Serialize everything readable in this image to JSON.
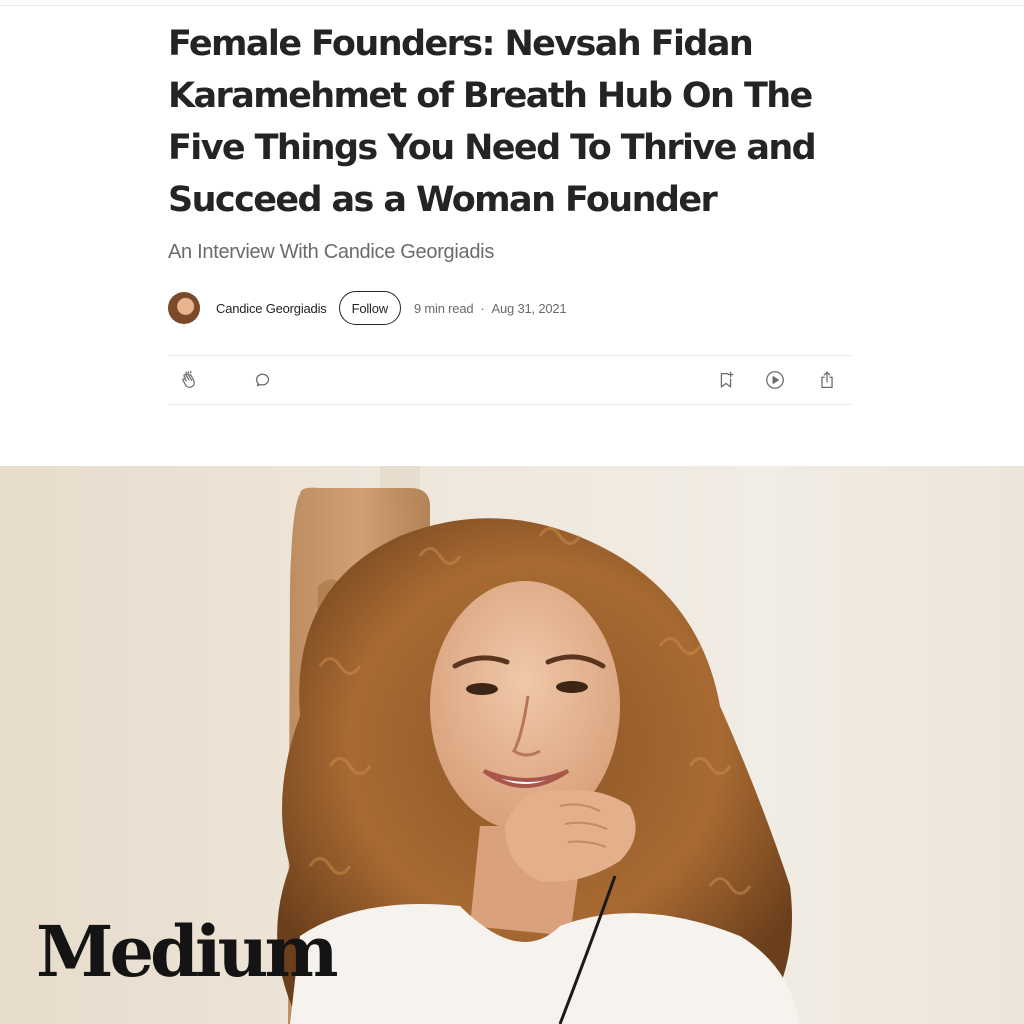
{
  "article": {
    "title": "Female Founders: Nevsah Fidan Karamehmet of Breath Hub On The Five Things You Need To Thrive and Succeed as a Woman Founder",
    "subtitle": "An Interview With Candice Georgiadis"
  },
  "byline": {
    "author": "Candice Georgiadis",
    "follow_label": "Follow",
    "read_time": "9 min read",
    "separator": "·",
    "date": "Aug 31, 2021"
  },
  "actions": {
    "icons": [
      "clap-icon",
      "comment-icon",
      "bookmark-add-icon",
      "play-icon",
      "share-icon"
    ]
  },
  "branding": {
    "logo": "Medium"
  },
  "colors": {
    "text_primary": "#242424",
    "text_secondary": "#6b6b6b",
    "divider": "#ececec"
  }
}
